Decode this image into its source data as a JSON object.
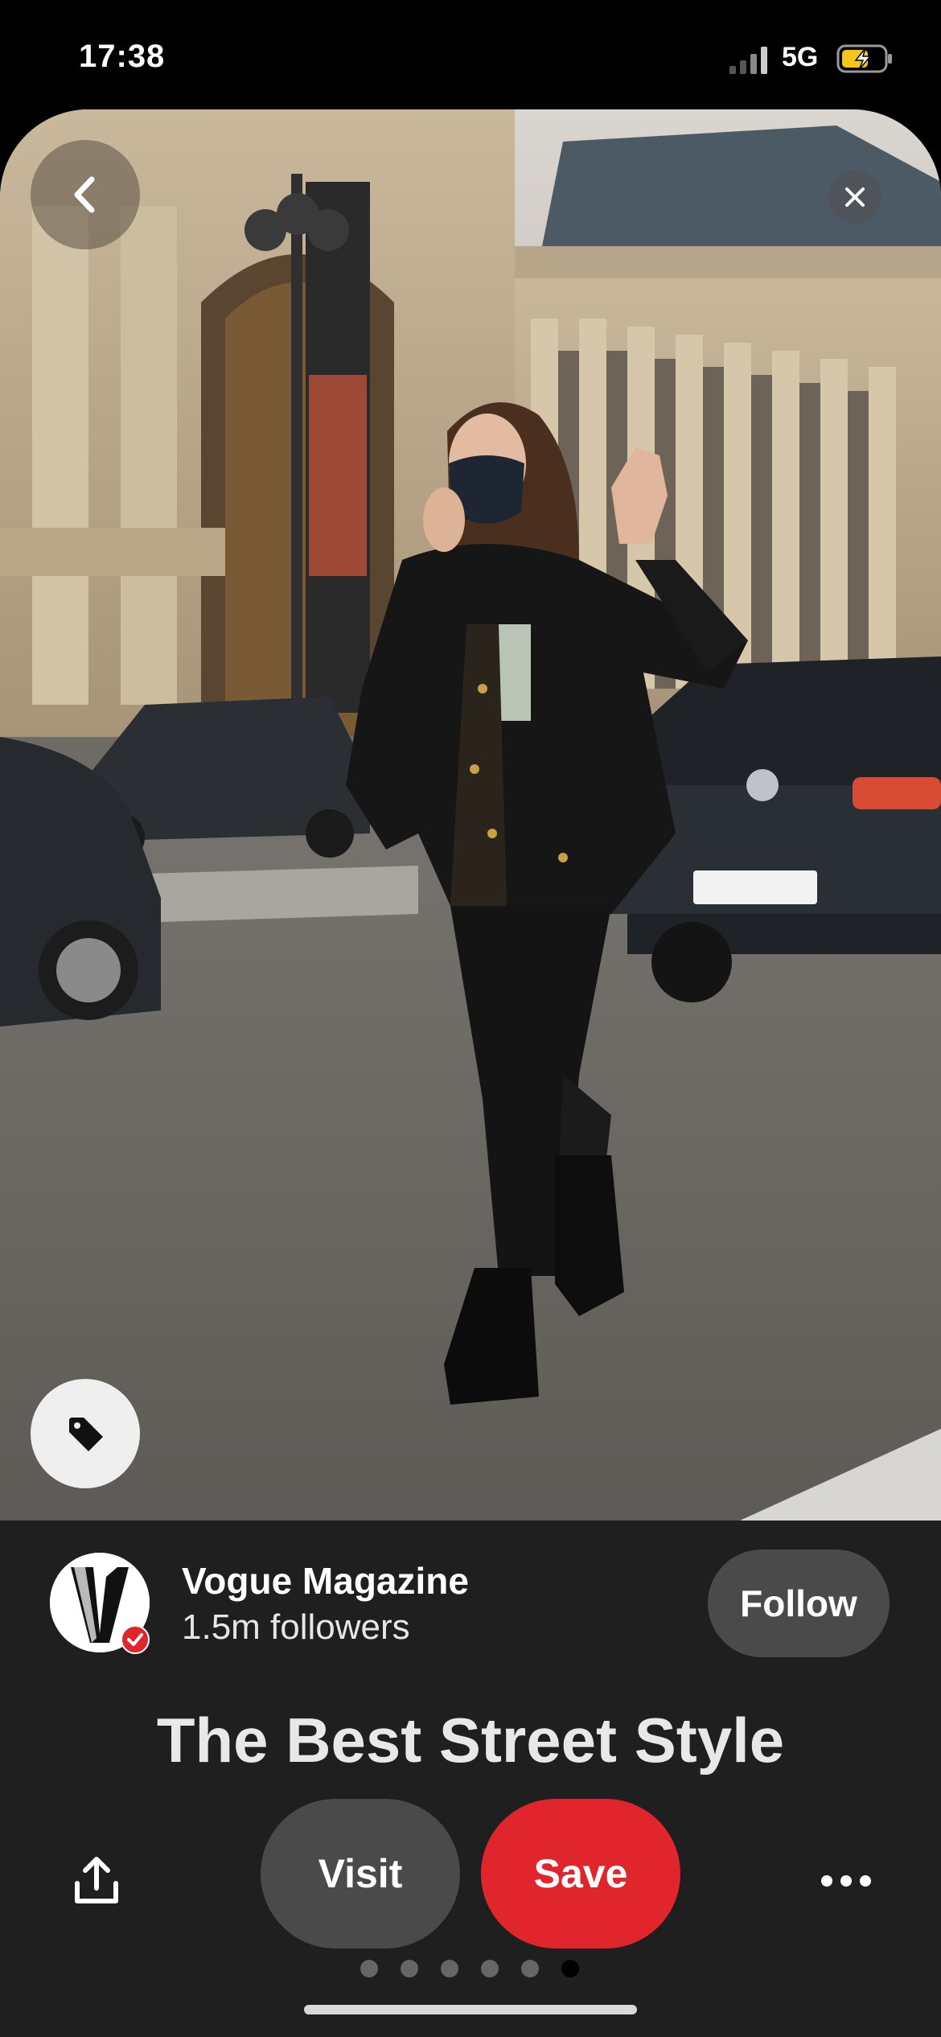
{
  "status_bar": {
    "time": "17:38",
    "network": "5G"
  },
  "hero": {
    "icons": {
      "back": "chevron-left-icon",
      "close": "close-icon",
      "tag": "tag-icon"
    }
  },
  "profile": {
    "name": "Vogue Magazine",
    "followers": "1.5m followers",
    "follow_label": "Follow",
    "verified_color": "#e1252d"
  },
  "pin": {
    "title": "The Best Street Style"
  },
  "actions": {
    "visit_label": "Visit",
    "save_label": "Save",
    "save_color": "#e1252d",
    "icons": {
      "share": "share-icon",
      "more": "more-horizontal-icon"
    }
  },
  "pagination": {
    "total": 6,
    "active_index": 5
  }
}
